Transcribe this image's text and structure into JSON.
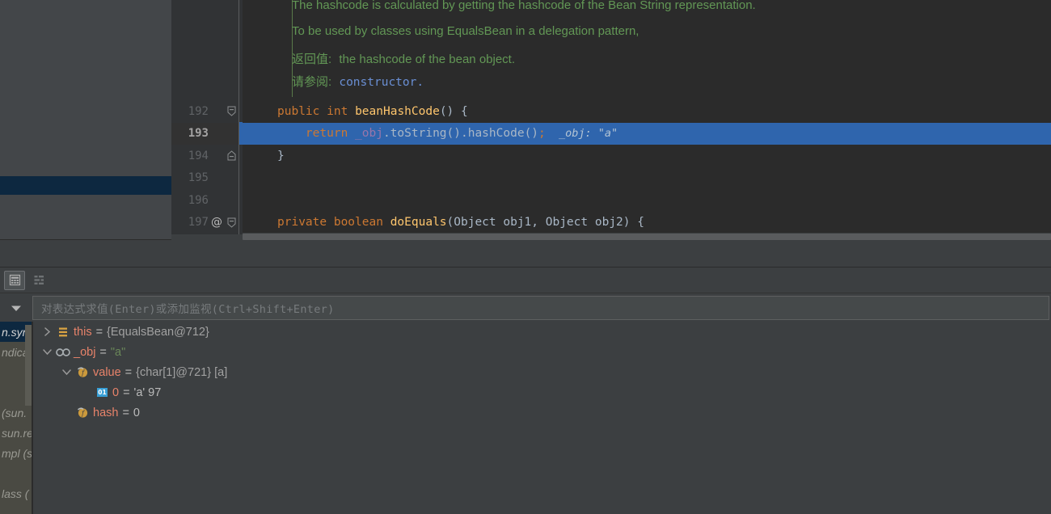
{
  "editor": {
    "javadoc": [
      {
        "text": "The hashcode is calculated by getting the hashcode of the Bean String representation."
      },
      {
        "text": "To be used by classes using EqualsBean in a delegation pattern,"
      }
    ],
    "javadoc_returns_label": "返回值:",
    "javadoc_returns_text": "the hashcode of the bean object.",
    "javadoc_see_label": "请参阅:",
    "javadoc_see_link": "constructor.",
    "lines": [
      {
        "number": "192",
        "annotation": "",
        "fold": "collapse-start",
        "selected": false,
        "tokens": [
          {
            "t": "public",
            "c": "kw"
          },
          {
            "t": " ",
            "c": "plain"
          },
          {
            "t": "int",
            "c": "kw"
          },
          {
            "t": " ",
            "c": "plain"
          },
          {
            "t": "beanHashCode",
            "c": "fn"
          },
          {
            "t": "() {",
            "c": "plain"
          }
        ],
        "indent": 0
      },
      {
        "number": "193",
        "annotation": "",
        "fold": "",
        "selected": true,
        "tokens": [
          {
            "t": "    ",
            "c": "plain"
          },
          {
            "t": "return",
            "c": "kw"
          },
          {
            "t": " ",
            "c": "plain"
          },
          {
            "t": "_obj",
            "c": "fld"
          },
          {
            "t": ".toString().hashCode()",
            "c": "plain"
          },
          {
            "t": ";",
            "c": "semi"
          }
        ],
        "inline_hint": "  _obj: \"a\"",
        "indent": 0
      },
      {
        "number": "194",
        "annotation": "",
        "fold": "collapse-end",
        "selected": false,
        "tokens": [
          {
            "t": "}",
            "c": "plain"
          }
        ],
        "indent": 0
      },
      {
        "number": "195",
        "annotation": "",
        "fold": "",
        "selected": false,
        "tokens": [],
        "indent": 0
      },
      {
        "number": "196",
        "annotation": "",
        "fold": "",
        "selected": false,
        "tokens": [],
        "indent": 0
      },
      {
        "number": "197",
        "annotation": "@",
        "fold": "collapse-start",
        "selected": false,
        "tokens": [
          {
            "t": "private",
            "c": "kw"
          },
          {
            "t": " ",
            "c": "plain"
          },
          {
            "t": "boolean",
            "c": "kw"
          },
          {
            "t": " ",
            "c": "plain"
          },
          {
            "t": "doEquals",
            "c": "fn"
          },
          {
            "t": "(Object obj1, Object obj2) {",
            "c": "plain"
          }
        ],
        "indent": 0
      }
    ]
  },
  "debugger": {
    "toolbar": {
      "buttons": [
        {
          "name": "show-values-in-table-icon",
          "active": true
        },
        {
          "name": "group-by-icon",
          "active": false
        }
      ]
    },
    "watch": {
      "placeholder": "对表达式求值(Enter)或添加监视(Ctrl+Shift+Enter)",
      "value": "",
      "dropdown_icon": "chevron-down-icon"
    },
    "variables": [
      {
        "indent": 0,
        "twisty": "collapsed",
        "icon": "object-field-icon",
        "name": "this",
        "eq": "=",
        "value": "{EqualsBean@712}",
        "value_kind": "obj",
        "extra": ""
      },
      {
        "indent": 0,
        "twisty": "expanded",
        "icon": "local-variable-icon",
        "name": "_obj",
        "eq": "=",
        "value": "\"a\"",
        "value_kind": "str",
        "extra": ""
      },
      {
        "indent": 1,
        "twisty": "expanded",
        "icon": "field-icon",
        "name": "value",
        "eq": "=",
        "value": "{char[1]@721}",
        "value_kind": "obj",
        "extra": "[a]"
      },
      {
        "indent": 2,
        "twisty": "none",
        "icon": "primitive-icon",
        "name": "0",
        "eq": "=",
        "value": "'a' 97",
        "value_kind": "num",
        "extra": ""
      },
      {
        "indent": 1,
        "twisty": "none",
        "icon": "field-icon",
        "name": "hash",
        "eq": "=",
        "value": "0",
        "value_kind": "num",
        "extra": ""
      }
    ],
    "frames": [
      {
        "text": "n.syn",
        "selected": true
      },
      {
        "text": "ndicat",
        "selected": false
      },
      {
        "text": "",
        "selected": false
      },
      {
        "text": "",
        "selected": false
      },
      {
        "text": "(sun.",
        "selected": false
      },
      {
        "text": "sun.re",
        "selected": false
      },
      {
        "text": "mpl (s",
        "selected": false
      },
      {
        "text": "",
        "selected": false
      },
      {
        "text": "lass (",
        "selected": false
      }
    ]
  },
  "colors": {
    "editor_bg": "#2b2b2b",
    "panel_bg": "#3c3f41",
    "gutter_bg": "#313335",
    "selection_blue": "#2f65ad",
    "javadoc_green": "#629755",
    "keyword_orange": "#cc7832",
    "method_yellow": "#ffc66d",
    "field_purple": "#9876aa",
    "string_green": "#6a8759",
    "var_name_salmon": "#e8836a",
    "frame_selected_navy": "#0d2840"
  }
}
